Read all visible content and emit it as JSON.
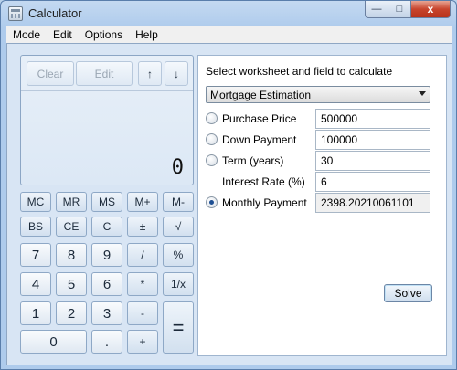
{
  "window": {
    "title": "Calculator",
    "icon": "calculator-icon"
  },
  "caption_buttons": {
    "minimize": "—",
    "maximize": "□",
    "close": "x"
  },
  "menu": [
    "Mode",
    "Edit",
    "Options",
    "Help"
  ],
  "calculator": {
    "display_buttons": [
      "Clear",
      "Edit",
      "↑",
      "↓"
    ],
    "display_value": "0",
    "keys": [
      [
        "MC",
        "MR",
        "MS",
        "M+",
        "M-"
      ],
      [
        "BS",
        "CE",
        "C",
        "±",
        "√"
      ],
      [
        "7",
        "8",
        "9",
        "/",
        "%"
      ],
      [
        "4",
        "5",
        "6",
        "*",
        "1/x"
      ],
      [
        "1",
        "2",
        "3",
        "-",
        "="
      ],
      [
        "0",
        ".",
        "+"
      ]
    ]
  },
  "worksheet": {
    "heading": "Select worksheet and field to calculate",
    "selected_worksheet": "Mortgage Estimation",
    "fields": [
      {
        "label": "Purchase Price",
        "value": "500000",
        "radio": true,
        "selected": false
      },
      {
        "label": "Down Payment",
        "value": "100000",
        "radio": true,
        "selected": false
      },
      {
        "label": "Term (years)",
        "value": "30",
        "radio": true,
        "selected": false
      },
      {
        "label": "Interest Rate (%)",
        "value": "6",
        "radio": false,
        "selected": false
      },
      {
        "label": "Monthly Payment",
        "value": "2398.20210061101",
        "radio": true,
        "selected": true
      }
    ],
    "solve_label": "Solve"
  }
}
